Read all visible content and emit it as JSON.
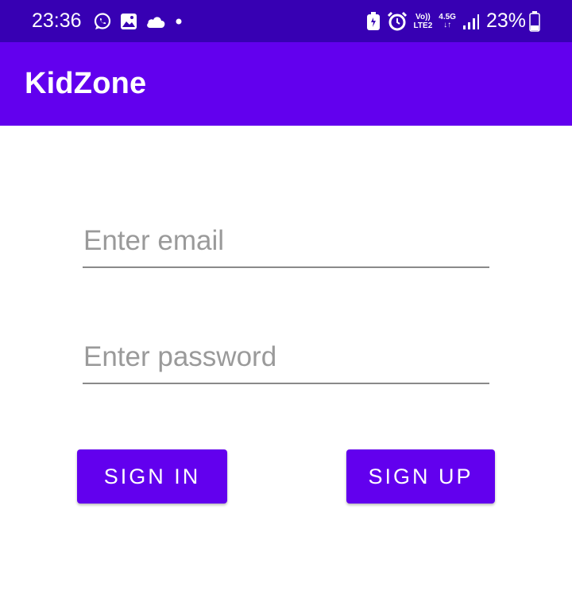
{
  "status_bar": {
    "time": "23:36",
    "network_top": "Vo))",
    "network_bottom": "LTE2",
    "network_type": "4.5G",
    "battery_percent": "23%",
    "icons": [
      "whatsapp-icon",
      "gallery-icon",
      "cloud-icon",
      "dot-icon",
      "battery-saver-icon",
      "alarm-icon",
      "signal-icon",
      "battery-icon"
    ]
  },
  "app_bar": {
    "title": "KidZone",
    "color": "#6200ee"
  },
  "form": {
    "email_placeholder": "Enter email",
    "email_value": "",
    "password_placeholder": "Enter password",
    "password_value": ""
  },
  "buttons": {
    "sign_in": "SIGN IN",
    "sign_up": "SIGN UP"
  },
  "colors": {
    "status_bar": "#3700b3",
    "primary": "#6200ee",
    "underline": "#8a8a8a",
    "placeholder": "#9a9a9a"
  }
}
